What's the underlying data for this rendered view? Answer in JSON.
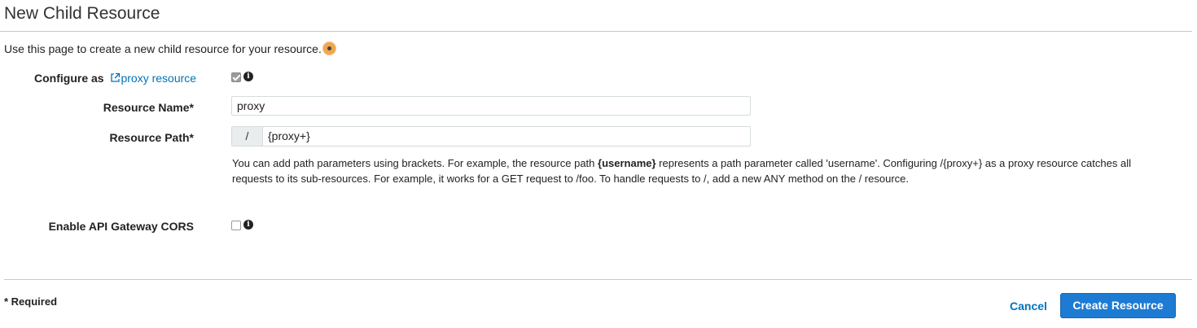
{
  "page": {
    "title": "New Child Resource",
    "intro": "Use this page to create a new child resource for your resource."
  },
  "form": {
    "configure_label": "Configure as",
    "proxy_link": "proxy resource",
    "proxy_checked": true,
    "resource_name_label": "Resource Name*",
    "resource_name_value": "proxy",
    "resource_path_label": "Resource Path*",
    "resource_path_prefix": "/",
    "resource_path_value": "{proxy+}",
    "help_part1": "You can add path parameters using brackets. For example, the resource path ",
    "help_bold": "{username}",
    "help_part2": " represents a path parameter called 'username'. Configuring /{proxy+} as a proxy resource catches all requests to its sub-resources. For example, it works for a GET request to /foo. To handle requests to /, add a new ANY method on the / resource.",
    "cors_label": "Enable API Gateway CORS",
    "cors_checked": false
  },
  "footer": {
    "required_note": "* Required",
    "cancel_label": "Cancel",
    "create_label": "Create Resource"
  },
  "icons": {
    "info": "info-icon",
    "external_link": "external-link-icon",
    "hint": "hint-dot-icon"
  },
  "colors": {
    "link": "#0073bb",
    "primary_button": "#1d7bd4",
    "hint": "#f0a64d"
  }
}
